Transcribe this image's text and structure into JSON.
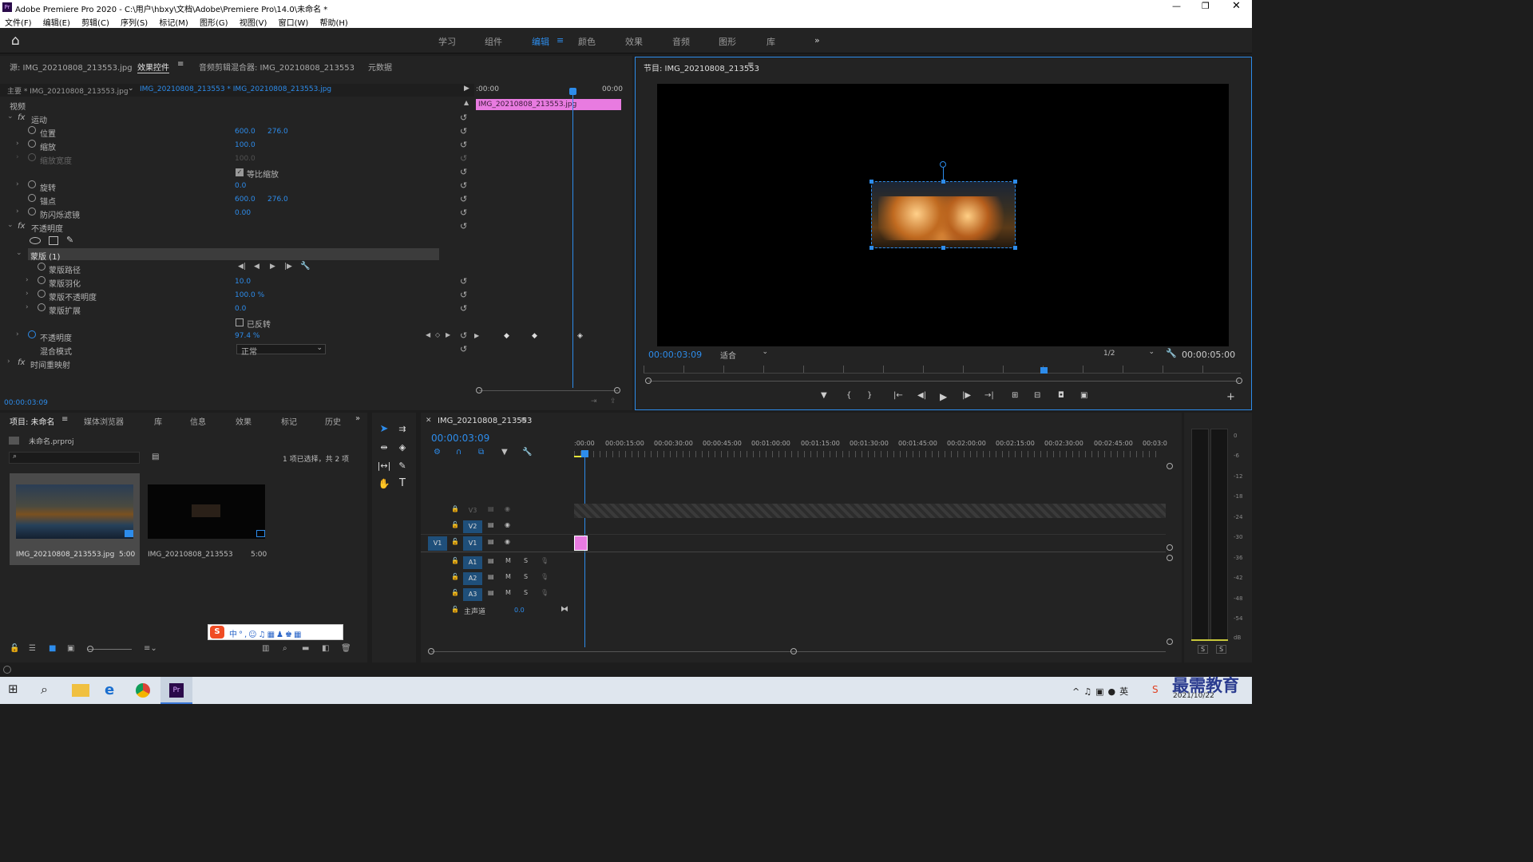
{
  "window": {
    "title": "Adobe Premiere Pro 2020 - C:\\用户\\hbxy\\文档\\Adobe\\Premiere Pro\\14.0\\未命名 *",
    "app_icon": "Pr"
  },
  "menu": [
    "文件(F)",
    "编辑(E)",
    "剪辑(C)",
    "序列(S)",
    "标记(M)",
    "图形(G)",
    "视图(V)",
    "窗口(W)",
    "帮助(H)"
  ],
  "workspaces": [
    "学习",
    "组件",
    "编辑",
    "颜色",
    "效果",
    "音频",
    "图形",
    "库"
  ],
  "workspace_active": "编辑",
  "source_tabs": [
    "源: IMG_20210808_213553.jpg",
    "效果控件",
    "音频剪辑混合器: IMG_20210808_213553",
    "元数据"
  ],
  "ec": {
    "master": "主要 * IMG_20210808_213553.jpg",
    "clip_sel": "IMG_20210808_213553 * IMG_20210808_213553.jpg",
    "tc_start": ":00:00",
    "tc_end": "00:00",
    "clip_name": "IMG_20210808_213553.jpg",
    "video": "视频",
    "motion": "运动",
    "pos_label": "位置",
    "pos_x": "600.0",
    "pos_y": "276.0",
    "scale_label": "缩放",
    "scale_val": "100.0",
    "scalew_label": "缩放宽度",
    "scalew_val": "100.0",
    "uniform": "等比缩放",
    "rot_label": "旋转",
    "rot_val": "0.0",
    "anchor_label": "锚点",
    "anchor_x": "600.0",
    "anchor_y": "276.0",
    "flicker_label": "防闪烁滤镜",
    "flicker_val": "0.00",
    "opacity_group": "不透明度",
    "mask": "蒙版 (1)",
    "mpath": "蒙版路径",
    "mfeather": "蒙版羽化",
    "mfeather_val": "10.0",
    "mopacity": "蒙版不透明度",
    "mopacity_val": "100.0 %",
    "mexpand": "蒙版扩展",
    "mexpand_val": "0.0",
    "inverted": "已反转",
    "opacity_label": "不透明度",
    "opacity_val": "97.4 %",
    "blend_label": "混合模式",
    "blend_val": "正常",
    "timeremap": "时间重映射",
    "tc": "00:00:03:09"
  },
  "program": {
    "title": "节目: IMG_20210808_213553",
    "tc": "00:00:03:09",
    "fit": "适合",
    "res": "1/2",
    "dur": "00:00:05:00"
  },
  "project": {
    "tabs": [
      "项目: 未命名",
      "媒体浏览器",
      "库",
      "信息",
      "效果",
      "标记",
      "历史"
    ],
    "file": "未命名.prproj",
    "count": "1 项已选择，共 2 项",
    "items": [
      {
        "name": "IMG_20210808_213553.jpg",
        "dur": "5:00"
      },
      {
        "name": "IMG_20210808_213553",
        "dur": "5:00"
      }
    ]
  },
  "timeline": {
    "name": "IMG_20210808_213553",
    "tc": "00:00:03:09",
    "ruler": [
      ":00:00",
      "00:00:15:00",
      "00:00:30:00",
      "00:00:45:00",
      "00:01:00:00",
      "00:01:15:00",
      "00:01:30:00",
      "00:01:45:00",
      "00:02:00:00",
      "00:02:15:00",
      "00:02:30:00",
      "00:02:45:00",
      "00:03:0"
    ],
    "tracks": {
      "v3": "V3",
      "v2": "V2",
      "v1": "V1",
      "a1": "A1",
      "a2": "A2",
      "a3": "A3",
      "src": "V1"
    },
    "m": "M",
    "s": "S",
    "master": "主声道",
    "master_val": "0.0"
  },
  "meter": {
    "labels": [
      "0",
      "-6",
      "-12",
      "-18",
      "-24",
      "-30",
      "-36",
      "-42",
      "-48",
      "-54",
      "dB"
    ],
    "solo": [
      "S",
      "S"
    ]
  },
  "taskbar": {
    "time": "2021/10/22",
    "watermark": "最需教育"
  },
  "colors": {
    "accent": "#2d8ceb",
    "clip": "#e87be0",
    "panel": "#232323"
  }
}
